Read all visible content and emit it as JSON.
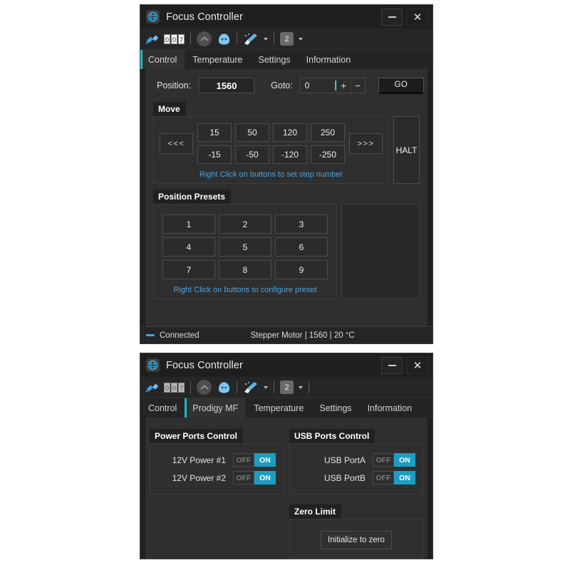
{
  "window_top": {
    "title": "Focus Controller",
    "app_icon": "swirl-globe-icon",
    "minimize_label": "",
    "close_label": "✕",
    "toolbar": {
      "plug_icon": "plug-connector-icon",
      "counter_digits": [
        "0",
        "0",
        "7"
      ],
      "up_icon": "chevron-up-icon",
      "blob_icon": "blob-icon",
      "broom_icon": "broom-icon",
      "badge_value": "2"
    },
    "tabs": [
      {
        "label": "Control",
        "active": true
      },
      {
        "label": "Temperature",
        "active": false
      },
      {
        "label": "Settings",
        "active": false
      },
      {
        "label": "Information",
        "active": false
      }
    ],
    "position_row": {
      "position_label": "Position:",
      "position_value": "1560",
      "goto_label": "Goto:",
      "goto_value": "0",
      "goto_placeholder": "0",
      "plus_label": "+",
      "minus_label": "−",
      "go_label": "GO"
    },
    "move_group": {
      "title": "Move",
      "back_label": "<<<",
      "forward_label": ">>>",
      "steps_positive": [
        "15",
        "50",
        "120",
        "250"
      ],
      "steps_negative": [
        "-15",
        "-50",
        "-120",
        "-250"
      ],
      "hint": "Right Click on buttons to set step number",
      "halt_label": "HALT"
    },
    "presets_group": {
      "title": "Position Presets",
      "buttons": [
        "1",
        "2",
        "3",
        "4",
        "5",
        "6",
        "7",
        "8",
        "9"
      ],
      "hint": "Right Click on buttons to configure preset"
    },
    "statusbar": {
      "connection": "Connected",
      "detail": "Stepper Motor | 1560 | 20 °C",
      "indicator_color": "#4da3dd"
    }
  },
  "window_bottom": {
    "title": "Focus Controller",
    "app_icon": "swirl-globe-icon",
    "close_label": "✕",
    "toolbar": {
      "plug_icon": "plug-connector-icon",
      "counter_digits": [
        "0",
        "0",
        "7"
      ],
      "up_icon": "chevron-up-icon",
      "blob_icon": "blob-icon",
      "broom_icon": "broom-icon",
      "badge_value": "2"
    },
    "tabs": [
      {
        "label": "Control",
        "active": false
      },
      {
        "label": "Prodigy MF",
        "active": true
      },
      {
        "label": "Temperature",
        "active": false
      },
      {
        "label": "Settings",
        "active": false
      },
      {
        "label": "Information",
        "active": false
      }
    ],
    "power_group": {
      "title": "Power Ports Control",
      "rows": [
        {
          "label": "12V Power #1",
          "off_label": "OFF",
          "on_label": "ON",
          "state": "ON"
        },
        {
          "label": "12V Power #2",
          "off_label": "OFF",
          "on_label": "ON",
          "state": "ON"
        }
      ]
    },
    "usb_group": {
      "title": "USB Ports Control",
      "rows": [
        {
          "label": "USB PortA",
          "off_label": "OFF",
          "on_label": "ON",
          "state": "ON"
        },
        {
          "label": "USB PortB",
          "off_label": "OFF",
          "on_label": "ON",
          "state": "ON"
        }
      ]
    },
    "zero_group": {
      "title": "Zero Limit",
      "button_label": "Initialize to zero"
    }
  },
  "colors": {
    "accent": "#1fb8c8",
    "toggle_on": "#1d9dc4",
    "hint_link": "#4da3dd",
    "window_bg": "#2f2f2f",
    "titlebar_bg": "#1f1f1f"
  }
}
